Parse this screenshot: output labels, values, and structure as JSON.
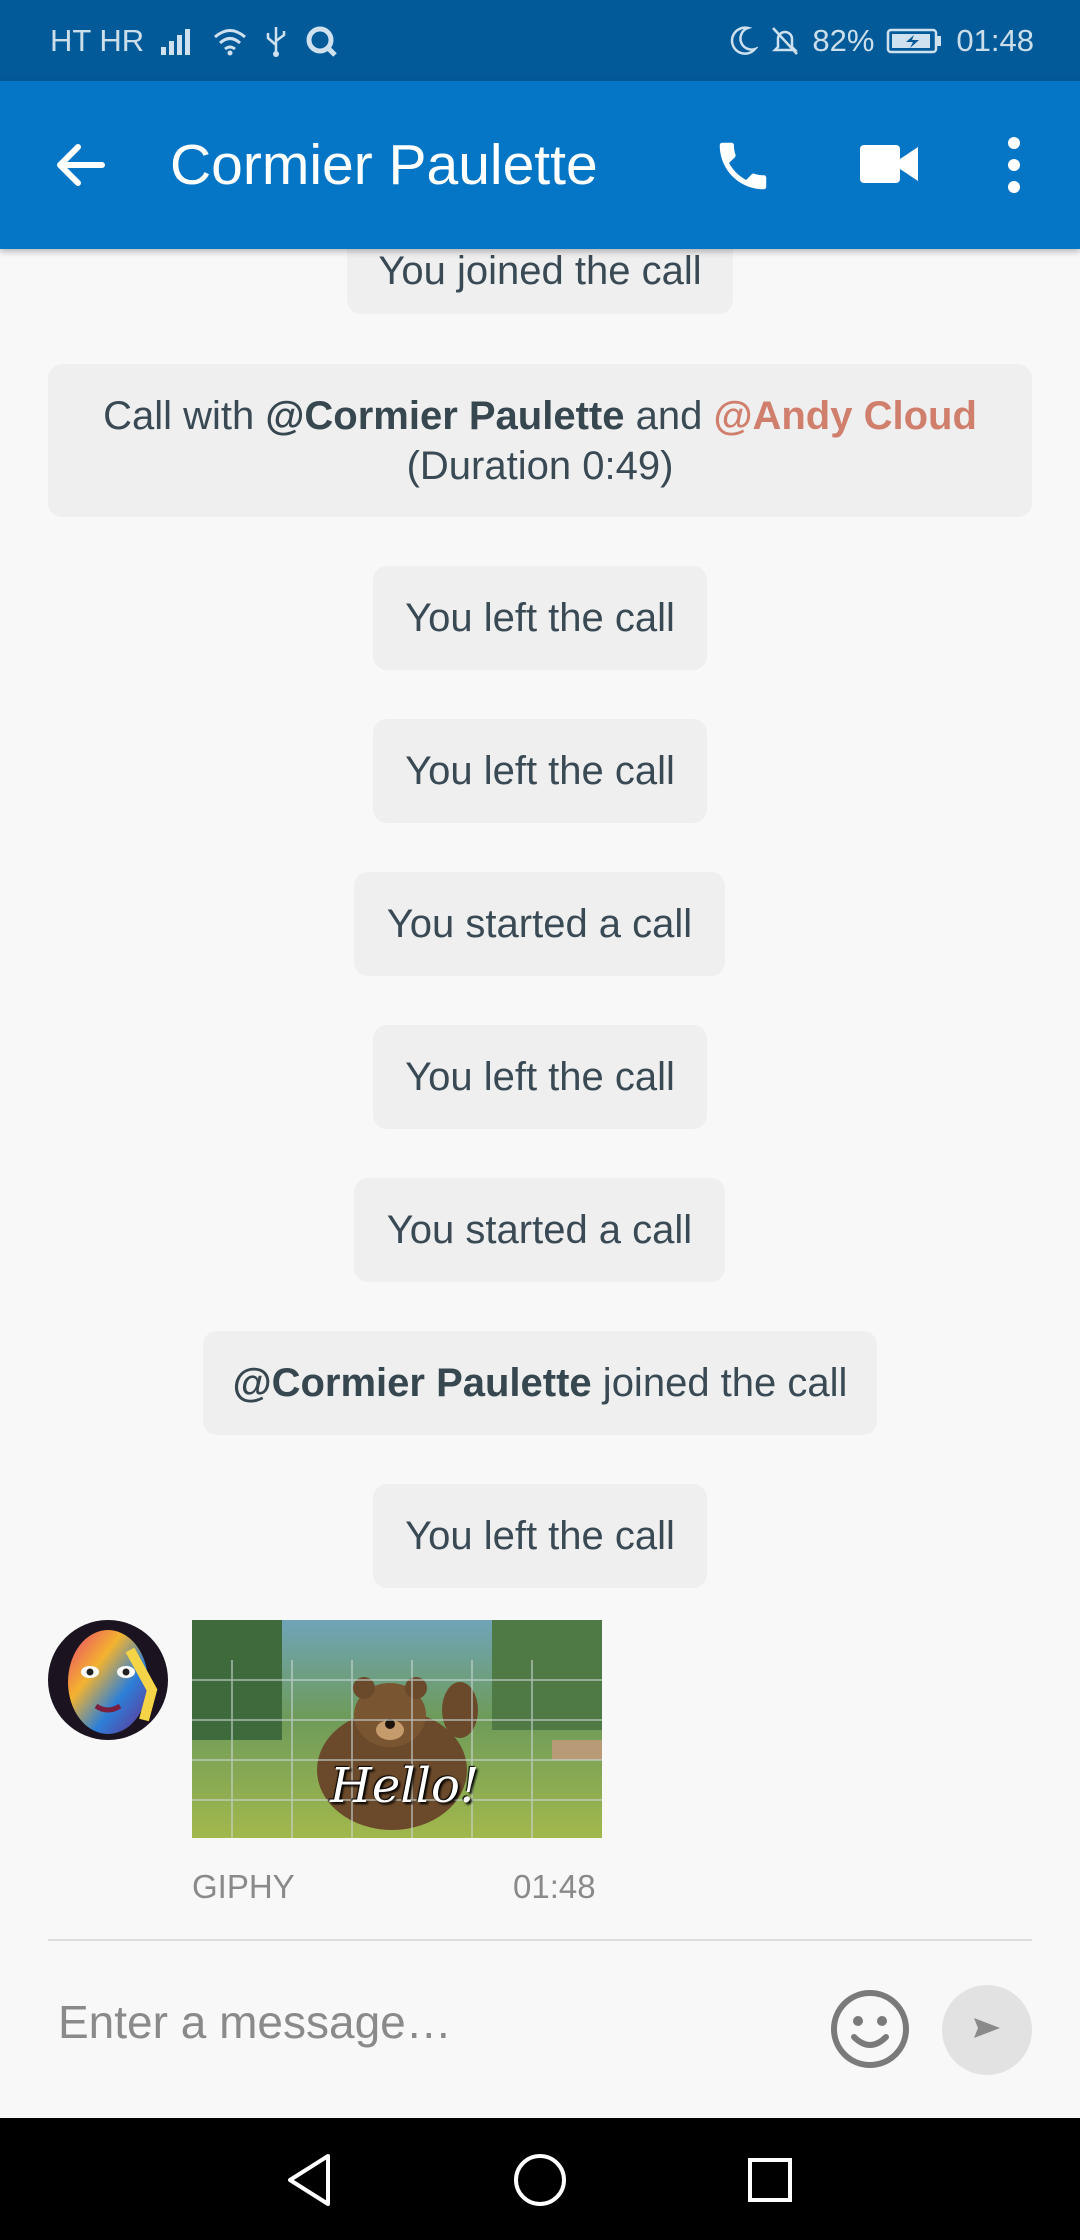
{
  "status_bar": {
    "carrier": "HT HR",
    "battery_percent": "82%",
    "time": "01:48",
    "icons": [
      "signal-icon",
      "wifi-icon",
      "usb-icon",
      "app-notification-icon",
      "moon-icon",
      "silent-bell-icon",
      "battery-charging-icon"
    ]
  },
  "header": {
    "title": "Cormier Paulette",
    "icons": [
      "back-arrow-icon",
      "phone-call-icon",
      "video-call-icon",
      "more-vert-icon"
    ]
  },
  "messages": [
    {
      "type": "system",
      "text": "You joined the call"
    },
    {
      "type": "system_summary",
      "prefix": "Call with ",
      "mention_1": "@Cormier Paulette",
      "middle": " and ",
      "mention_2": "@Andy Cloud",
      "suffix": "(Duration 0:49)"
    },
    {
      "type": "system",
      "text": "You left the call"
    },
    {
      "type": "system",
      "text": "You left the call"
    },
    {
      "type": "system",
      "text": "You started a call"
    },
    {
      "type": "system",
      "text": "You left the call"
    },
    {
      "type": "system",
      "text": "You started a call"
    },
    {
      "type": "system_mention",
      "mention": "@Cormier Paulette",
      "text": " joined the call"
    },
    {
      "type": "system",
      "text": "You left the call"
    },
    {
      "type": "gif",
      "caption": "Hello!",
      "source": "GIPHY",
      "time": "01:48"
    }
  ],
  "composer": {
    "placeholder": "Enter a message…",
    "icons": [
      "emoji-icon",
      "send-icon"
    ]
  },
  "nav_bar": {
    "icons": [
      "nav-back-icon",
      "nav-home-icon",
      "nav-recents-icon"
    ]
  },
  "colors": {
    "status_bar": "#035a98",
    "app_bar": "#0575c6",
    "mention_other": "#d07f6c",
    "system_bubble": "#efefef"
  }
}
